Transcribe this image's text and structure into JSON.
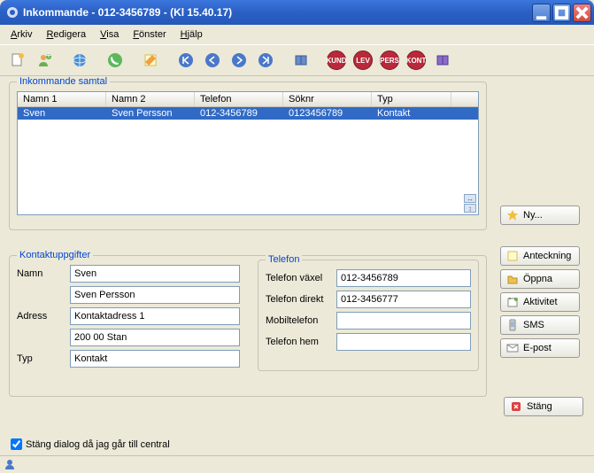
{
  "window": {
    "title": "Inkommande - 012-3456789 - (Kl 15.40.17)"
  },
  "menu": {
    "arkiv": "Arkiv",
    "redigera": "Redigera",
    "visa": "Visa",
    "fonster": "Fönster",
    "hjalp": "Hjälp"
  },
  "toolbar_badges": {
    "kund": "KUND",
    "lev": "LEV",
    "pers": "PERS",
    "kont": "KONT"
  },
  "list": {
    "legend": "Inkommande samtal",
    "headers": {
      "namn1": "Namn 1",
      "namn2": "Namn 2",
      "telefon": "Telefon",
      "soknr": "Söknr",
      "typ": "Typ"
    },
    "rows": [
      {
        "namn1": "Sven",
        "namn2": "Sven Persson",
        "telefon": "012-3456789",
        "soknr": "0123456789",
        "typ": "Kontakt"
      }
    ]
  },
  "buttons": {
    "ny": "Ny...",
    "anteckning": "Anteckning",
    "oppna": "Öppna",
    "aktivitet": "Aktivitet",
    "sms": "SMS",
    "epost": "E-post",
    "stang": "Stäng"
  },
  "details": {
    "legend": "Kontaktuppgifter",
    "labels": {
      "namn": "Namn",
      "adress": "Adress",
      "typ": "Typ"
    },
    "values": {
      "namn1": "Sven",
      "namn2": "Sven Persson",
      "adress1": "Kontaktadress 1",
      "adress2": "200 00 Stan",
      "typ": "Kontakt"
    },
    "phone": {
      "legend": "Telefon",
      "labels": {
        "vaxel": "Telefon växel",
        "direkt": "Telefon direkt",
        "mobil": "Mobiltelefon",
        "hem": "Telefon hem"
      },
      "values": {
        "vaxel": "012-3456789",
        "direkt": "012-3456777",
        "mobil": "",
        "hem": ""
      }
    }
  },
  "checkbox": {
    "label": "Stäng dialog då jag går till central",
    "checked": true
  }
}
